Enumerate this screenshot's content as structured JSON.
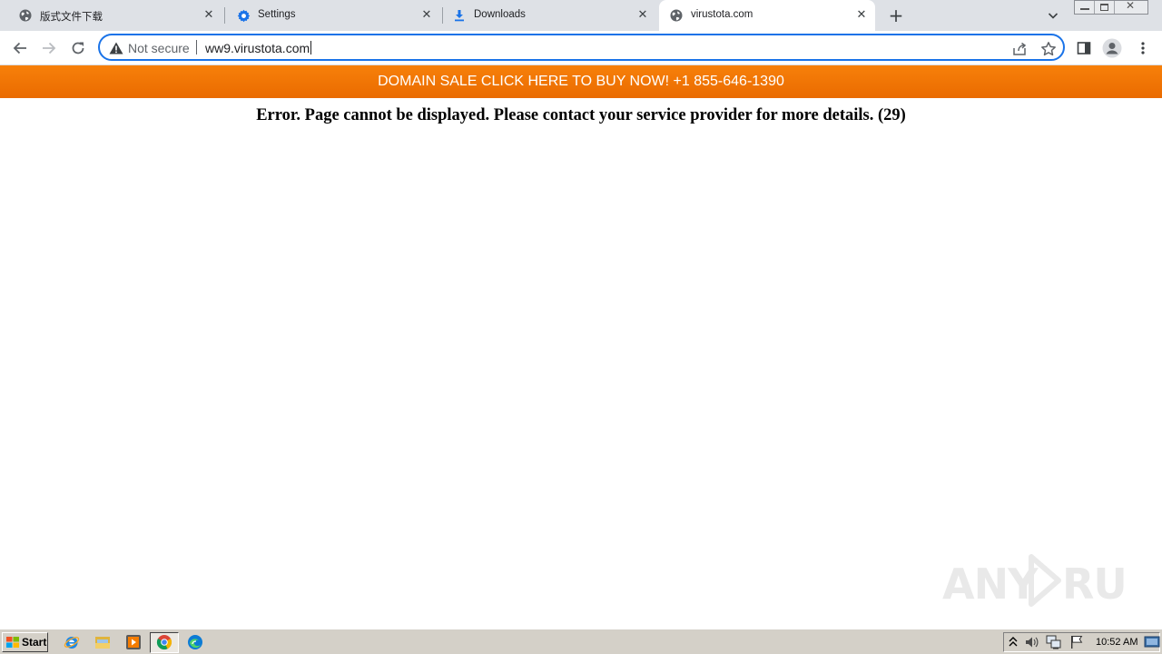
{
  "browser": {
    "tabs": [
      {
        "title": "版式文件下载",
        "icon": "globe-icon",
        "active": false
      },
      {
        "title": "Settings",
        "icon": "gear-icon",
        "active": false
      },
      {
        "title": "Downloads",
        "icon": "download-icon",
        "active": false
      },
      {
        "title": "virustota.com",
        "icon": "globe-icon",
        "active": true
      }
    ],
    "omnibox": {
      "security_label": "Not secure",
      "url": "ww9.virustota.com"
    },
    "accent_color": "#1a73e8"
  },
  "page": {
    "banner_text": "DOMAIN SALE CLICK HERE TO BUY NOW! +1 855-646-1390",
    "banner_color": "#f57c00",
    "error_message": "Error. Page cannot be displayed. Please contact your service provider for more details. (29)"
  },
  "taskbar": {
    "start_label": "Start",
    "clock": "10:52 AM",
    "pinned": [
      "internet-explorer-icon",
      "folder-icon",
      "media-player-icon",
      "chrome-icon",
      "edge-icon"
    ],
    "tray": [
      "show-hidden-icons",
      "volume-icon",
      "network-icon",
      "action-center-flag-icon"
    ]
  }
}
